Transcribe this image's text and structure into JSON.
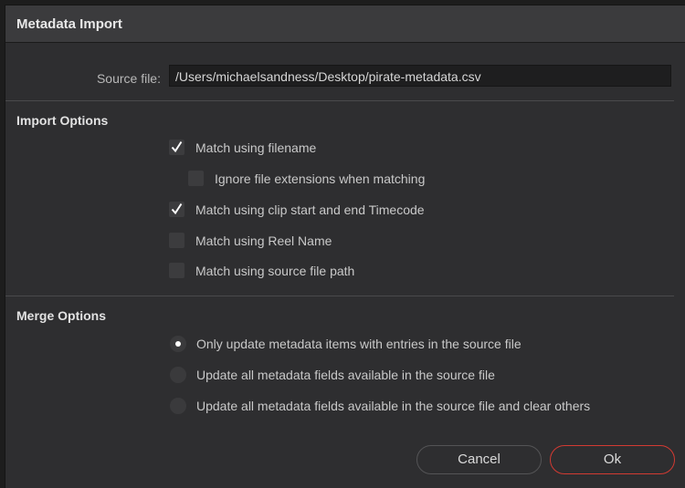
{
  "dialog": {
    "title": "Metadata Import"
  },
  "source": {
    "label": "Source file:",
    "value": "/Users/michaelsandness/Desktop/pirate-metadata.csv"
  },
  "import_options": {
    "title": "Import Options",
    "items": [
      {
        "label": "Match using filename",
        "checked": true
      },
      {
        "label": "Ignore file extensions when matching",
        "checked": false
      },
      {
        "label": "Match using clip start and end Timecode",
        "checked": true
      },
      {
        "label": "Match using Reel Name",
        "checked": false
      },
      {
        "label": "Match using source file path",
        "checked": false
      }
    ]
  },
  "merge_options": {
    "title": "Merge Options",
    "items": [
      {
        "label": "Only update metadata items with entries in the source file",
        "selected": true
      },
      {
        "label": "Update all metadata fields available in the source file",
        "selected": false
      },
      {
        "label": "Update all metadata fields available in the source file and clear others",
        "selected": false
      }
    ]
  },
  "buttons": {
    "cancel": "Cancel",
    "ok": "Ok"
  },
  "colors": {
    "ok_border": "#d23a32",
    "background": "#2e2e30",
    "check": "#ffffff"
  },
  "icons": {
    "checked": "checkmark-icon",
    "radio_selected": "radio-dot-icon"
  }
}
